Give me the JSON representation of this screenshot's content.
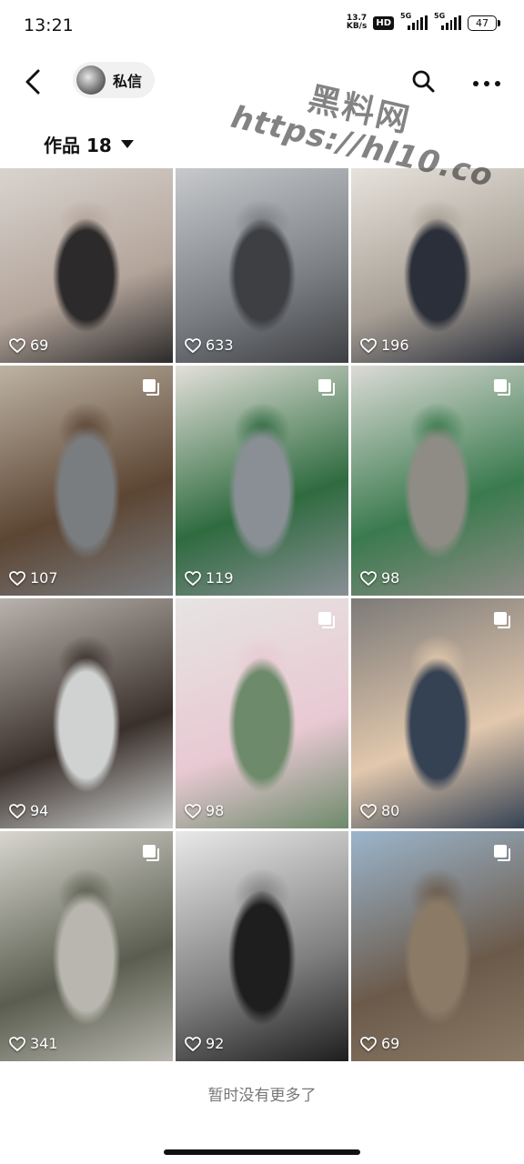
{
  "status_bar": {
    "time": "13:21",
    "net_speed_top": "13.7",
    "net_speed_bottom": "KB/s",
    "hd": "HD",
    "sig1": "5G",
    "sig2": "5G",
    "battery": "47"
  },
  "header": {
    "dm_label": "私信",
    "watermark_line1": "黑料网",
    "watermark_line2": "https://hl10.co"
  },
  "works_tab": {
    "label": "作品 18"
  },
  "tiles": [
    {
      "likes": "69",
      "multi": false,
      "colors": [
        "#d9d4cf",
        "#b3a49a",
        "#2c2a2a"
      ]
    },
    {
      "likes": "633",
      "multi": false,
      "colors": [
        "#c7c9cc",
        "#7b7f84",
        "#3e3f42"
      ]
    },
    {
      "likes": "196",
      "multi": false,
      "colors": [
        "#e7e3dc",
        "#a79f95",
        "#2b2f3a"
      ]
    },
    {
      "likes": "107",
      "multi": true,
      "colors": [
        "#bdb3a4",
        "#5c4533",
        "#7a7d80"
      ]
    },
    {
      "likes": "119",
      "multi": true,
      "colors": [
        "#e3e0da",
        "#2f6b3f",
        "#8a8f96"
      ]
    },
    {
      "likes": "98",
      "multi": true,
      "colors": [
        "#dcdbd6",
        "#3a7a4e",
        "#8f8c86"
      ]
    },
    {
      "likes": "94",
      "multi": false,
      "colors": [
        "#b9b3ad",
        "#3a302b",
        "#cfd2d1"
      ]
    },
    {
      "likes": "98",
      "multi": true,
      "colors": [
        "#e6e4e2",
        "#e8c9d3",
        "#6d8a6a"
      ]
    },
    {
      "likes": "80",
      "multi": true,
      "colors": [
        "#7c7a78",
        "#e2c8ad",
        "#354253"
      ]
    },
    {
      "likes": "341",
      "multi": true,
      "colors": [
        "#d8d6cf",
        "#5a5d4f",
        "#b8b6ae"
      ]
    },
    {
      "likes": "92",
      "multi": false,
      "colors": [
        "#e9e9e9",
        "#7e7e7e",
        "#1e1e1e"
      ]
    },
    {
      "likes": "69",
      "multi": true,
      "colors": [
        "#9bb5cc",
        "#6b5a4a",
        "#8a7a66"
      ]
    }
  ],
  "footer": {
    "text": "暂时没有更多了"
  }
}
